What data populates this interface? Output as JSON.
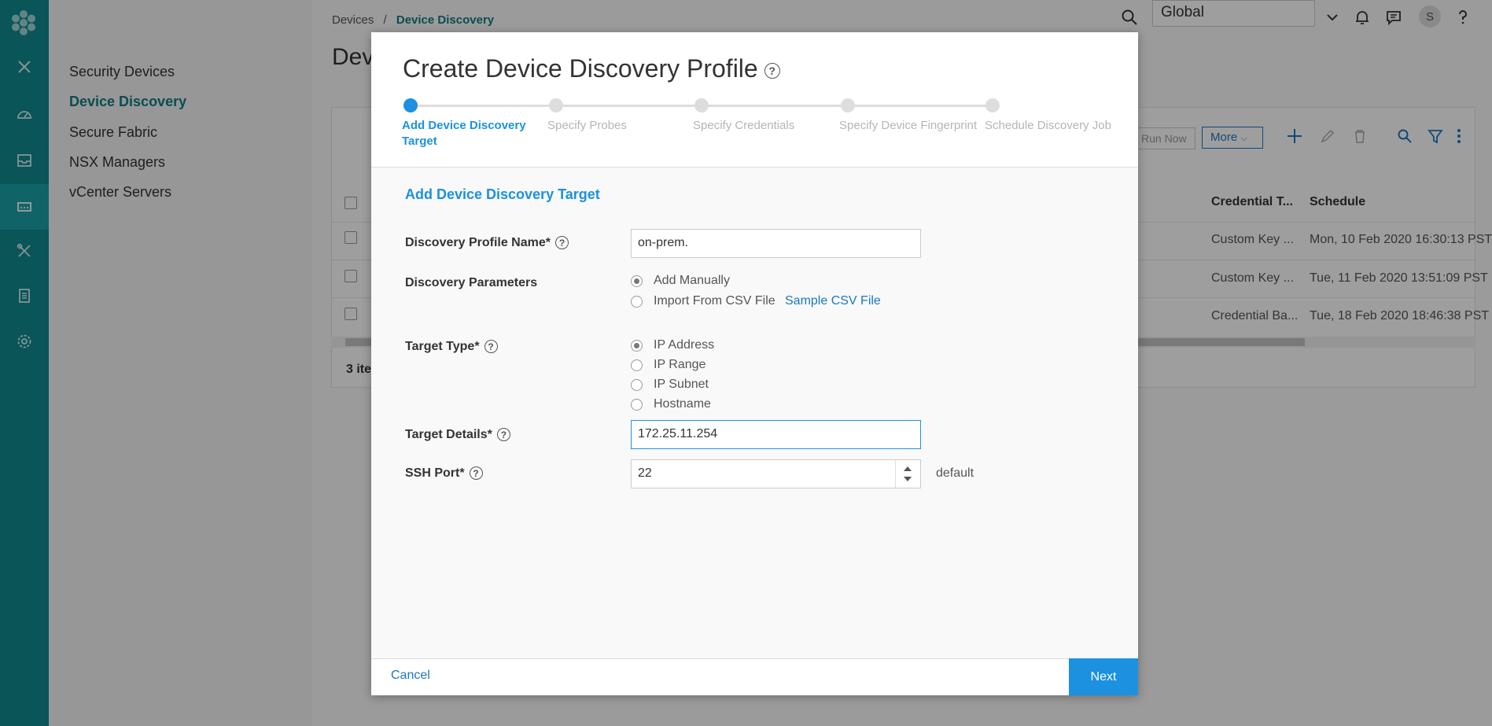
{
  "sidebar_nav": {
    "items": [
      "Security Devices",
      "Device Discovery",
      "Secure Fabric",
      "NSX Managers",
      "vCenter Servers"
    ]
  },
  "breadcrumb": {
    "parent": "Devices",
    "separator": "/",
    "current": "Device Discovery"
  },
  "page": {
    "title_partial": "Devi"
  },
  "topbar": {
    "scope": "Global",
    "avatar_initial": "S"
  },
  "table": {
    "toolbar": {
      "run_now": "Run Now",
      "more": "More"
    },
    "columns": [
      "Credential T...",
      "Schedule"
    ],
    "rows": [
      {
        "credential": "Custom Key ...",
        "schedule": "Mon, 10 Feb 2020 16:30:13 PST"
      },
      {
        "credential": "Custom Key ...",
        "schedule": "Tue, 11 Feb 2020 13:51:09 PST"
      },
      {
        "credential": "Credential Ba...",
        "schedule": "Tue, 18 Feb 2020 18:46:38 PST"
      }
    ],
    "footer_partial": "3 ite"
  },
  "modal": {
    "title": "Create Device Discovery Profile",
    "steps": [
      "Add Device Discovery Target",
      "Specify Probes",
      "Specify Credentials",
      "Specify Device Fingerprint",
      "Schedule Discovery Job"
    ],
    "active_step": 0,
    "section_title": "Add Device Discovery Target",
    "fields": {
      "profile_name": {
        "label": "Discovery Profile Name*",
        "value": "on-prem."
      },
      "discovery_params": {
        "label": "Discovery Parameters",
        "options": [
          "Add Manually",
          "Import From CSV File"
        ],
        "selected": "Add Manually",
        "sample_link": "Sample CSV File"
      },
      "target_type": {
        "label": "Target Type*",
        "options": [
          "IP Address",
          "IP Range",
          "IP Subnet",
          "Hostname"
        ],
        "selected": "IP Address"
      },
      "target_details": {
        "label": "Target Details*",
        "value": "172.25.11.254"
      },
      "ssh_port": {
        "label": "SSH Port*",
        "value": "22",
        "note": "default"
      }
    },
    "footer": {
      "cancel": "Cancel",
      "next": "Next"
    }
  },
  "colors": {
    "rail": "#0f8a8f",
    "accent": "#1b91e0",
    "link": "#1b78c2"
  }
}
